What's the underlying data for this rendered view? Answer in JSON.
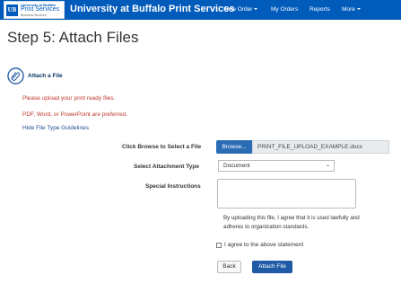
{
  "logo": {
    "mark": "UB",
    "line1": "University at Buffalo",
    "line2": "Print Services",
    "line3": "Business Services"
  },
  "navbar": {
    "brand": "University at Buffalo Print Services",
    "items": [
      {
        "label": "New Order",
        "dropdown": true
      },
      {
        "label": "My Orders",
        "dropdown": false
      },
      {
        "label": "Reports",
        "dropdown": false
      },
      {
        "label": "More",
        "dropdown": true
      }
    ]
  },
  "page": {
    "title": "Step 5: Attach Files"
  },
  "section": {
    "icon": "paperclip-icon",
    "label": "Attach a File",
    "messages": [
      "Please upload your print ready files.",
      "PDF, Word, or PowerPoint are preferred."
    ],
    "link": "Hide File Type Guidelines"
  },
  "form": {
    "file_label": "Click Browse to Select a File",
    "browse_label": "Browse...",
    "file_name": "PRINT_FILE_UPLOAD_EXAMPLE.docx",
    "type_label": "Select Attachment Type",
    "type_value": "Document",
    "instructions_label": "Special Instructions",
    "instructions_value": "",
    "consent_text": "By uploading this file, I agree that it is used lawfully and adheres to organization standards.",
    "checkbox_label": "I agree to the above statement",
    "checkbox_checked": false,
    "back_label": "Back",
    "attach_label": "Attach File"
  },
  "colors": {
    "navbar": "#005bbb",
    "primary_button": "#1f5aa6",
    "warning_text": "#c0392b"
  }
}
